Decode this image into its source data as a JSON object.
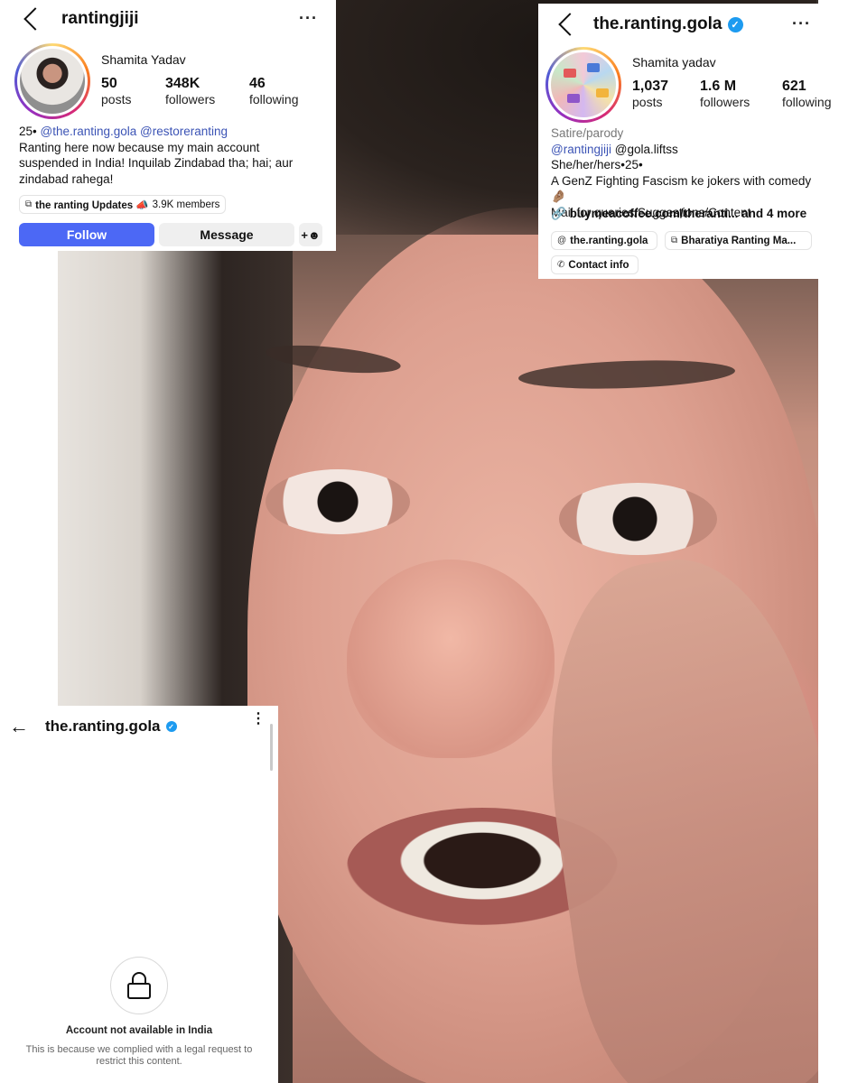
{
  "panel_left": {
    "username": "rantingjiji",
    "full_name": "Shamita Yadav",
    "stats": [
      {
        "num": "50",
        "label": "posts"
      },
      {
        "num": "348K",
        "label": "followers"
      },
      {
        "num": "46",
        "label": "following"
      }
    ],
    "bio_prefix": "25•",
    "bio_mentions": "@the.ranting.gola @restoreranting",
    "bio_line1": "Ranting here now because my  main account",
    "bio_line2": "suspended in India!  Inquilab Zindabad tha; hai; aur",
    "bio_line3": "zindabad rahega!",
    "channel_name": "the ranting Updates 📣",
    "channel_members": "3.9K members",
    "follow_label": "Follow",
    "message_label": "Message"
  },
  "panel_right": {
    "username": "the.ranting.gola",
    "full_name": "Shamita yadav",
    "stats": [
      {
        "num": "1,037",
        "label": "posts"
      },
      {
        "num": "1.6 M",
        "label": "followers"
      },
      {
        "num": "621",
        "label": "following"
      }
    ],
    "category": "Satire/parody",
    "mentions_link": "@rantingjiji",
    "mentions_text": " @gola.liftss",
    "bio_line1": "She/her/hers•25•",
    "bio_line2": "A GenZ Fighting Fascism ke jokers with comedy🤌🏽",
    "bio_line3": "Mail for queries/Suggestions/Content",
    "website": "buymeacoffee.com/theranti...",
    "more_links": "and 4 more",
    "threads_chip": "the.ranting.gola",
    "channel_chip": "Bharatiya Ranting Ma...",
    "contact_chip": "Contact info"
  },
  "panel_bottom": {
    "username": "the.ranting.gola",
    "na_title": "Account not available in India",
    "na_desc": "This is because we complied with a legal request to restrict this content."
  },
  "colors": {
    "follow_button": "#4c68f5",
    "link": "#3b53b5",
    "verified": "#1d9bf0"
  }
}
